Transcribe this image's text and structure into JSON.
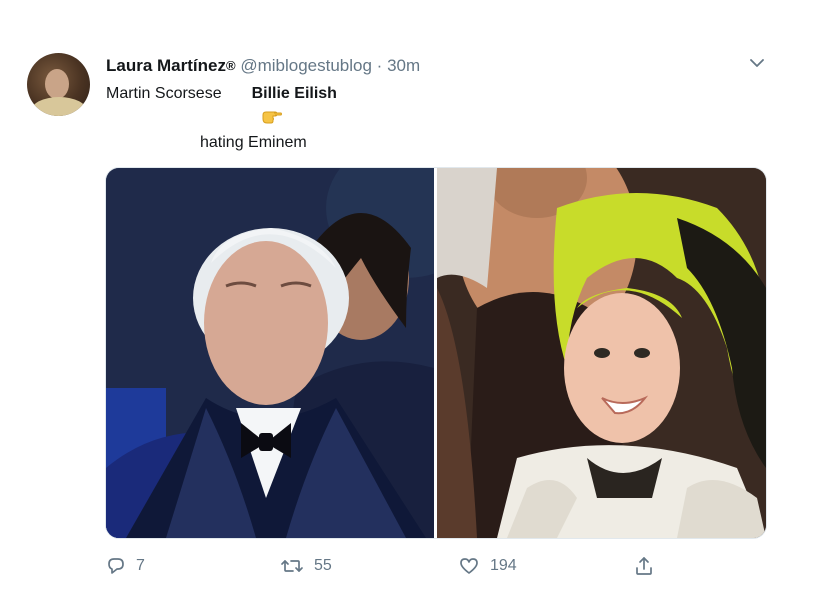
{
  "tweet": {
    "author_name": "Laura Martínez",
    "author_badge": "®",
    "handle": "@miblogestublog",
    "separator": "·",
    "time": "30m",
    "line1_left": "Martin Scorsese",
    "line1_right": "Billie Eilish",
    "line2": "hating Eminem"
  },
  "actions": {
    "reply_count": "7",
    "retweet_count": "55",
    "like_count": "194"
  },
  "icons": {
    "caret": "chevron-down-icon",
    "reply": "reply-icon",
    "retweet": "retweet-icon",
    "like": "heart-icon",
    "share": "share-icon",
    "hand": "pointing-hand-emoji"
  },
  "colors": {
    "text": "#14171a",
    "secondary": "#657786",
    "border": "#e1e8ed"
  }
}
